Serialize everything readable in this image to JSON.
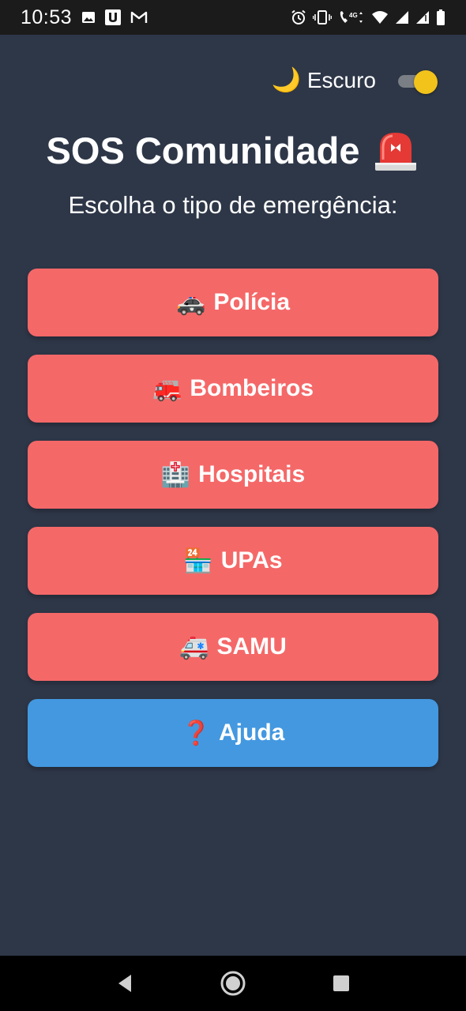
{
  "status_bar": {
    "time": "10:53",
    "network": "4G",
    "icons_left": [
      "image-icon",
      "u-app-icon",
      "gmail-icon"
    ],
    "icons_right": [
      "alarm-icon",
      "vibrate-icon",
      "wifi-calling-icon",
      "wifi-icon",
      "signal-icon",
      "signal-icon-2",
      "battery-icon"
    ]
  },
  "theme": {
    "label": "Escuro",
    "icon": "moon-icon",
    "enabled": true,
    "knob_color": "#f2c31a"
  },
  "title": "SOS Comunidade",
  "title_icon": "siren-icon",
  "subtitle": "Escolha o tipo de emergência:",
  "buttons": [
    {
      "label": "Polícia",
      "emoji": "🚓",
      "icon": "police-car-icon",
      "color": "#f56868"
    },
    {
      "label": "Bombeiros",
      "emoji": "🚒",
      "icon": "fire-truck-icon",
      "color": "#f56868"
    },
    {
      "label": "Hospitais",
      "emoji": "🏥",
      "icon": "hospital-icon",
      "color": "#f56868"
    },
    {
      "label": "UPAs",
      "emoji": "🏪",
      "icon": "convenience-store-icon",
      "color": "#f56868"
    },
    {
      "label": "SAMU",
      "emoji": "🚑",
      "icon": "ambulance-icon",
      "color": "#f56868"
    }
  ],
  "help_button": {
    "label": "Ajuda",
    "emoji": "❓",
    "icon": "question-mark-icon",
    "color": "#4398e0"
  },
  "colors": {
    "background": "#2e3748",
    "status_bar": "#1b1b1b",
    "nav_bar": "#000000"
  },
  "nav": [
    "back-icon",
    "home-icon",
    "recents-icon"
  ]
}
